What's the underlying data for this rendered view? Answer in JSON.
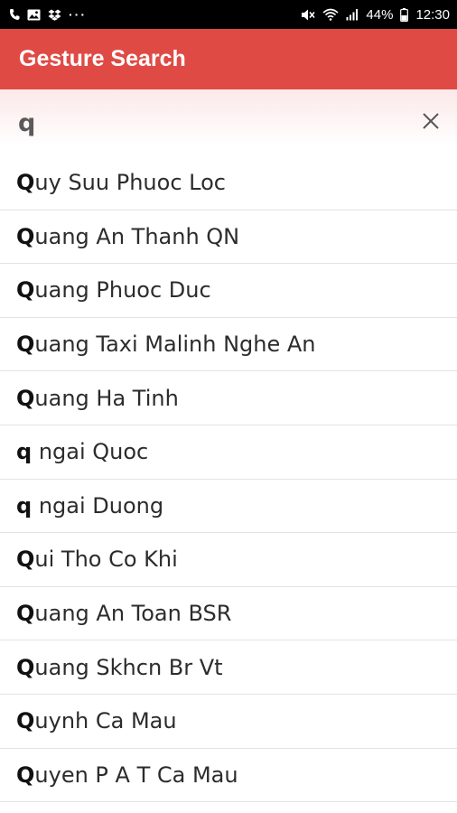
{
  "status_bar": {
    "notif_icons": [
      "phone-call-icon",
      "image-icon",
      "dropbox-icon"
    ],
    "more_dots": "···",
    "battery_percent": "44%",
    "time": "12:30"
  },
  "app_bar": {
    "title": "Gesture Search",
    "color": "#e04a44"
  },
  "search": {
    "query": "q"
  },
  "results": [
    {
      "match": "Q",
      "rest": "uy Suu Phuoc Loc"
    },
    {
      "match": "Q",
      "rest": "uang An Thanh QN"
    },
    {
      "match": "Q",
      "rest": "uang Phuoc Duc"
    },
    {
      "match": "Q",
      "rest": "uang Taxi Malinh Nghe An"
    },
    {
      "match": "Q",
      "rest": "uang Ha Tinh"
    },
    {
      "match": "q",
      "rest": " ngai Quoc"
    },
    {
      "match": "q",
      "rest": " ngai Duong"
    },
    {
      "match": "Q",
      "rest": "ui Tho Co Khi"
    },
    {
      "match": "Q",
      "rest": "uang An Toan BSR"
    },
    {
      "match": "Q",
      "rest": "uang Skhcn Br Vt"
    },
    {
      "match": "Q",
      "rest": "uynh Ca Mau"
    },
    {
      "match": "Q",
      "rest": "uyen P A T Ca Mau"
    }
  ]
}
